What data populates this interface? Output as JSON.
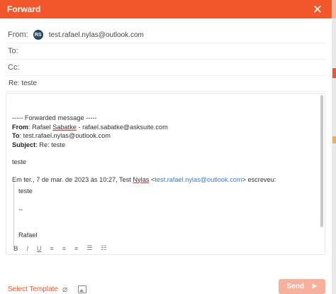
{
  "header": {
    "title": "Forward",
    "close_icon": "close-icon"
  },
  "from": {
    "label": "From:",
    "avatar_initials": "RS",
    "email": "test.rafael.nylas@outlook.com"
  },
  "to": {
    "label": "To:"
  },
  "cc": {
    "label": "Cc:"
  },
  "subject": {
    "value": "Re: teste"
  },
  "body": {
    "forward_header": "----- Forwarded message -----",
    "from_label": "From",
    "from_name": "Rafael",
    "from_surname": "Sabatke",
    "from_address": " - rafael.sabatke@asksuite.com",
    "to_label": "To",
    "to_value": ": test.rafael.nylas@outlook.com",
    "subject_label": "Subject",
    "subject_value": ": Re: teste",
    "message": "teste",
    "quote_intro_before": "Em ter., 7 de mar. de 2023 às 10:27, Test ",
    "quote_intro_name": "Nylas",
    "quote_intro_link": "test.rafael.nylas@outlook.com",
    "quote_intro_after": "> escreveu:",
    "quote_intro_lt": " <",
    "quote_line1": "teste",
    "quote_line2": "--",
    "quote_line3": "Rafael"
  },
  "toolbar": {
    "bold": "B",
    "italic": "I",
    "underline": "U",
    "align_left": "≡",
    "align_center": "≡",
    "align_right": "≡",
    "bullet_list": "☰",
    "numbered_list": "☷"
  },
  "footer": {
    "select_template": "Select Template",
    "send_label": "Send"
  },
  "colors": {
    "accent": "#f2572b",
    "send_disabled": "#f7b09c",
    "link": "#3b7cc4"
  }
}
